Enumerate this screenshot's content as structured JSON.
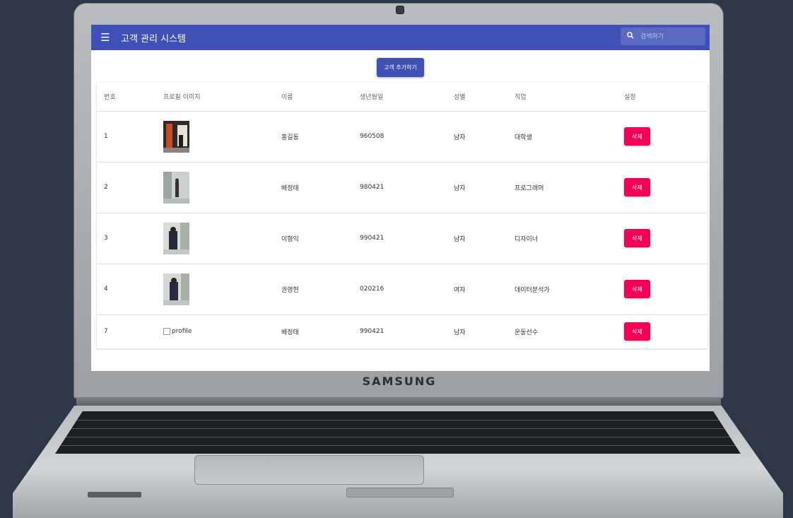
{
  "device": {
    "brand": "SAMSUNG"
  },
  "appbar": {
    "title": "고객 관리 시스템",
    "search_placeholder": "검색하기"
  },
  "add_button": "고객 추가하기",
  "table": {
    "headers": [
      "번호",
      "프로필 이미지",
      "이름",
      "생년월일",
      "성별",
      "직업",
      "설정"
    ],
    "rows": [
      {
        "id": "1",
        "name": "홍길동",
        "birthday": "960508",
        "gender": "남자",
        "job": "대학생",
        "action": "삭제"
      },
      {
        "id": "2",
        "name": "배정태",
        "birthday": "980421",
        "gender": "남자",
        "job": "프로그래머",
        "action": "삭제"
      },
      {
        "id": "3",
        "name": "이형익",
        "birthday": "990421",
        "gender": "남자",
        "job": "디자이너",
        "action": "삭제"
      },
      {
        "id": "4",
        "name": "권영현",
        "birthday": "020216",
        "gender": "여자",
        "job": "데이터분석가",
        "action": "삭제"
      },
      {
        "id": "7",
        "image_alt": "profile",
        "name": "배정태",
        "birthday": "990421",
        "gender": "남자",
        "job": "운동선수",
        "action": "삭제"
      }
    ]
  }
}
